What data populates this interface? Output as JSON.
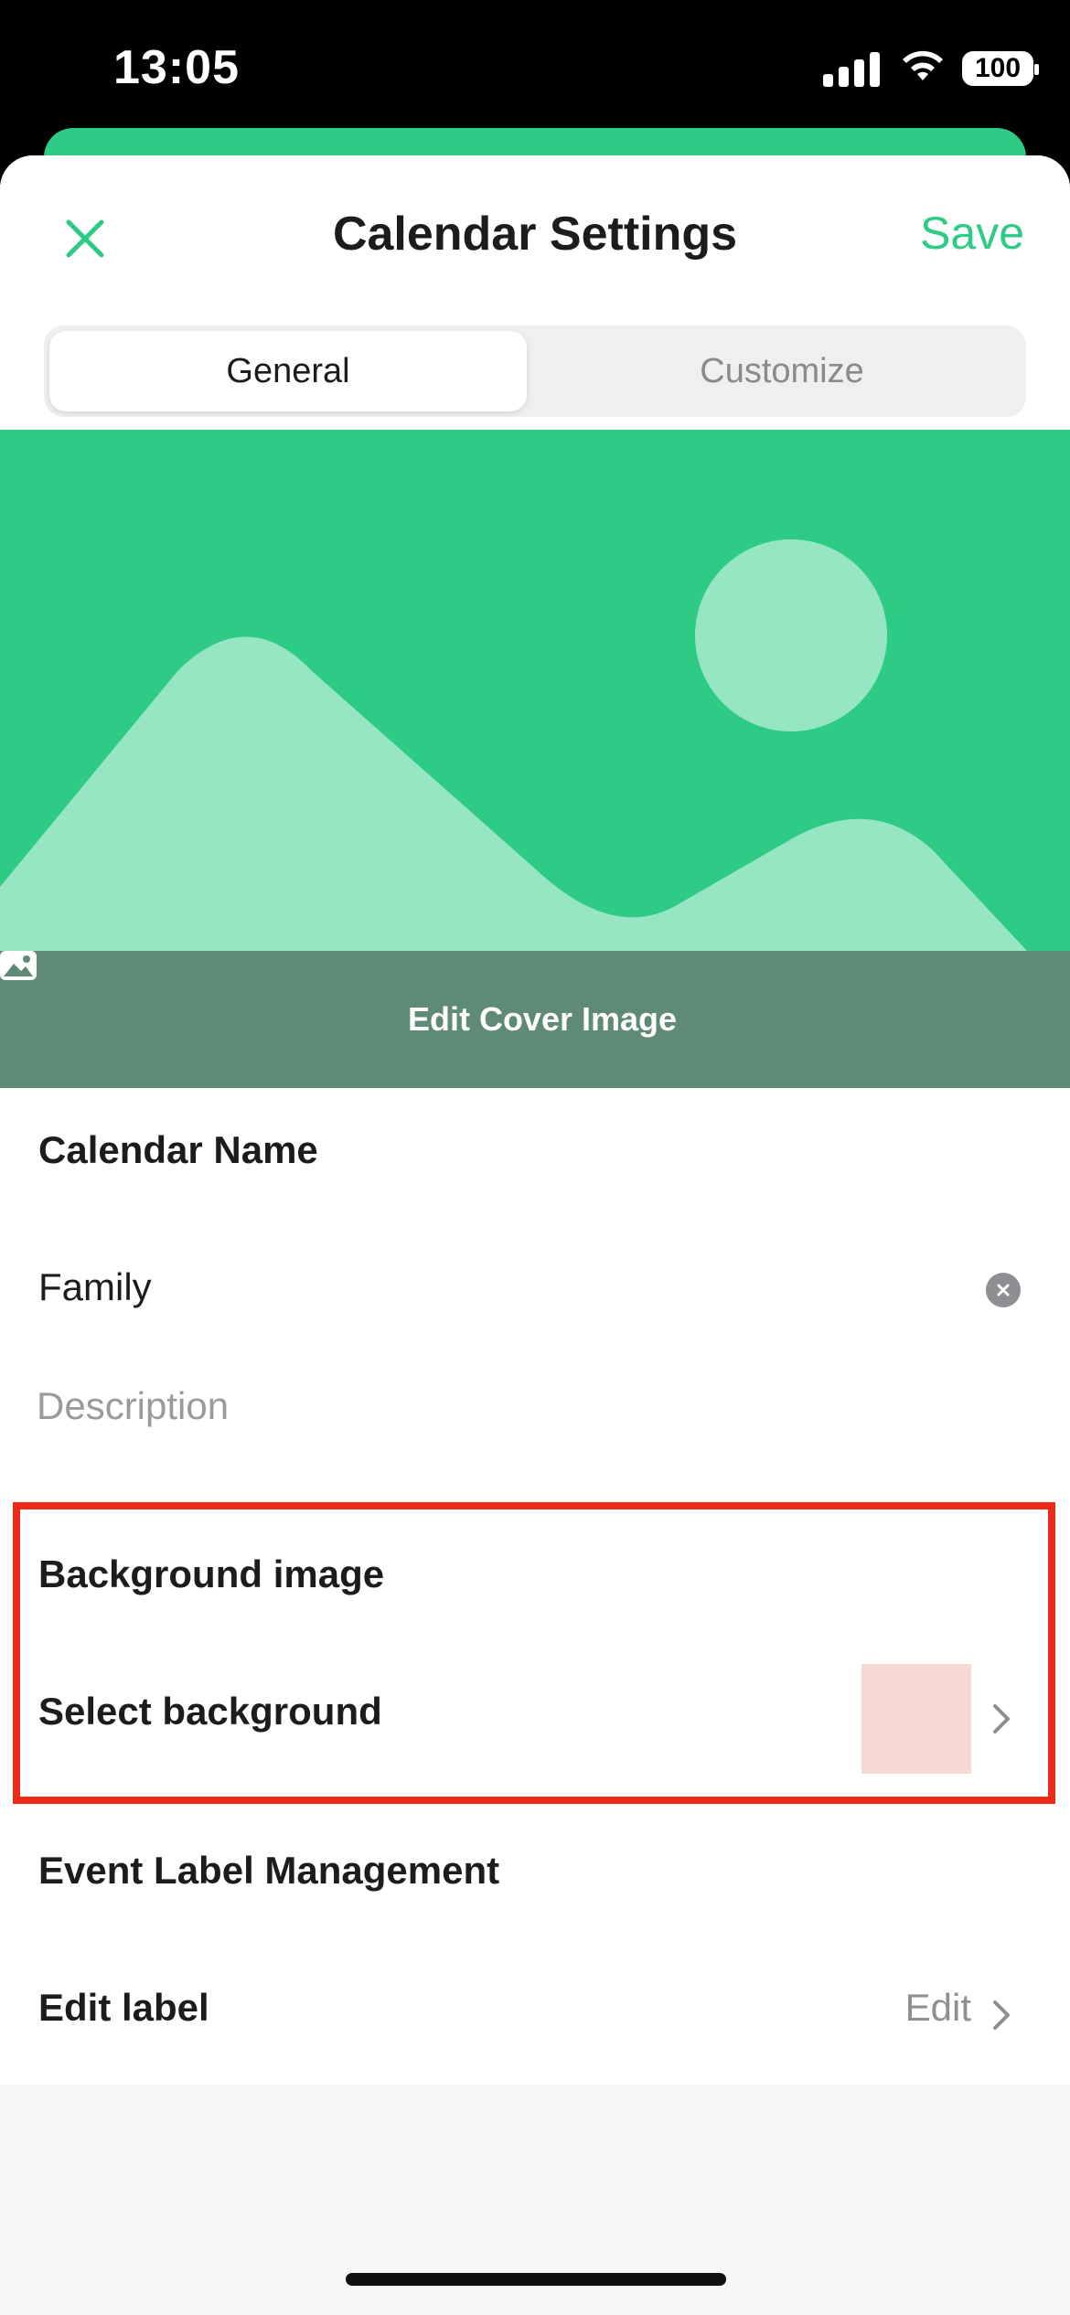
{
  "status_bar": {
    "time": "13:05",
    "battery": "100"
  },
  "header": {
    "title": "Calendar Settings",
    "save_label": "Save"
  },
  "tabs": [
    {
      "label": "General",
      "active": true
    },
    {
      "label": "Customize",
      "active": false
    }
  ],
  "cover": {
    "edit_label": "Edit Cover Image"
  },
  "calendar_name": {
    "section_title": "Calendar Name",
    "value": "Family",
    "description_placeholder": "Description"
  },
  "background": {
    "section_title": "Background image",
    "row_label": "Select background",
    "swatch_color": "#f5d9d2"
  },
  "labels": {
    "section_title": "Event Label Management",
    "row_label": "Edit label",
    "row_value": "Edit"
  },
  "colors": {
    "accent": "#2ecb85",
    "highlight": "#ee2b1a"
  }
}
